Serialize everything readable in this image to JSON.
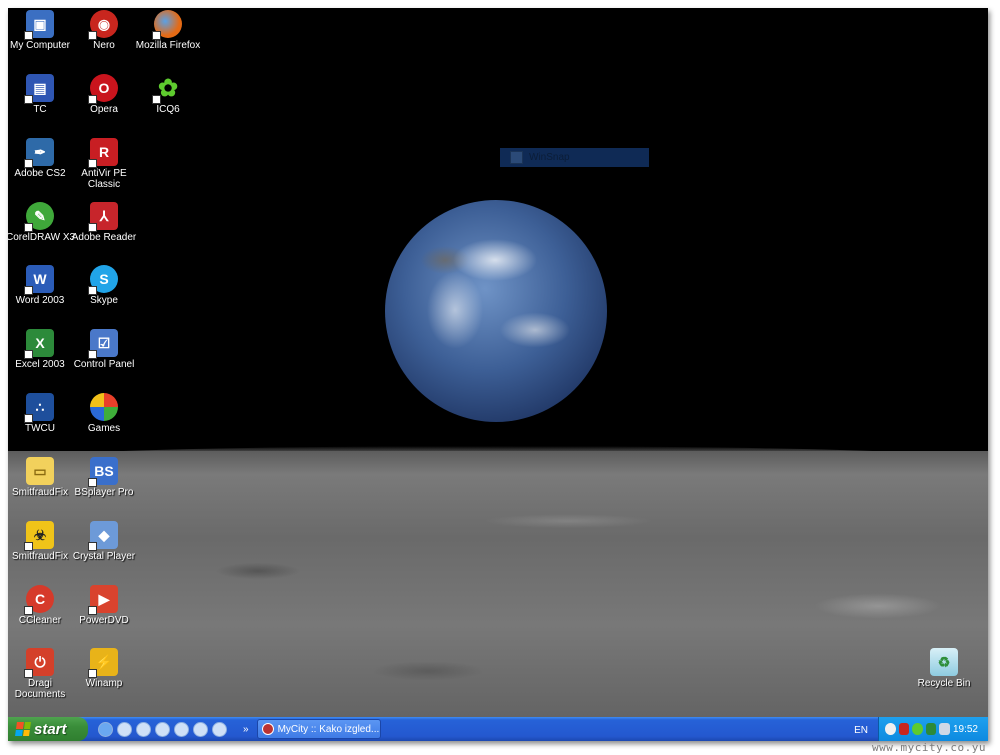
{
  "desktop": {
    "icons": [
      {
        "label": "My Computer",
        "icon": "computer-icon",
        "color": "#3b6fc2"
      },
      {
        "label": "Nero",
        "icon": "nero-icon",
        "color": "#c8261e"
      },
      {
        "label": "Mozilla Firefox",
        "icon": "firefox-icon",
        "color": "#e46a15"
      },
      {
        "label": "TC",
        "icon": "floppy-icon",
        "color": "#2f56b3"
      },
      {
        "label": "Opera",
        "icon": "opera-icon",
        "color": "#c9141d"
      },
      {
        "label": "ICQ6",
        "icon": "icq-flower-icon",
        "color": "#5ecb2e"
      },
      {
        "label": "Adobe  CS2",
        "icon": "adobe-cs2-icon",
        "color": "#2e6aa8"
      },
      {
        "label": "AntiVir PE",
        "label2": "Classic",
        "icon": "antivir-icon",
        "color": "#c81e23"
      },
      {
        "label": "CorelDRAW X3",
        "icon": "coreldraw-icon",
        "color": "#3fa83a"
      },
      {
        "label": "Adobe Reader",
        "icon": "adobe-reader-icon",
        "color": "#c7252b"
      },
      {
        "label": "Word 2003",
        "icon": "word-icon",
        "color": "#2b5cb8"
      },
      {
        "label": "Skype",
        "icon": "skype-icon",
        "color": "#21a4e8"
      },
      {
        "label": "Excel 2003",
        "icon": "excel-icon",
        "color": "#2c8a3a"
      },
      {
        "label": "Control Panel",
        "icon": "control-panel-icon",
        "color": "#4a78c9"
      },
      {
        "label": "TWCU",
        "icon": "twcu-icon",
        "color": "#1e4f9c"
      },
      {
        "label": "Games",
        "icon": "games-icon",
        "color": "#e8a419"
      },
      {
        "label": "SmitfraudFix",
        "icon": "folder-icon",
        "color": "#f2d15c"
      },
      {
        "label": "BSplayer Pro",
        "icon": "bsplayer-icon",
        "color": "#3a6fcb"
      },
      {
        "label": "SmitfraudFix",
        "icon": "biohazard-icon",
        "color": "#f0c419"
      },
      {
        "label": "Crystal Player",
        "icon": "crystal-player-icon",
        "color": "#6d9ad8"
      },
      {
        "label": "CCleaner",
        "icon": "ccleaner-icon",
        "color": "#d63a2a"
      },
      {
        "label": "PowerDVD",
        "icon": "powerdvd-icon",
        "color": "#d9432e"
      },
      {
        "label": "Dragi",
        "label2": "Documents",
        "icon": "power-button-icon",
        "color": "#d4402a"
      },
      {
        "label": "Winamp",
        "icon": "winamp-bolt-icon",
        "color": "#e8b319"
      },
      {
        "label": "Recycle Bin",
        "icon": "recycle-bin-icon",
        "color": "#9ed7e6"
      }
    ]
  },
  "winsnap": {
    "label": "WinSnap"
  },
  "taskbar": {
    "start_label": "start",
    "quick_launch": [
      "ie-icon",
      "chrome-like-icon",
      "desktop-icon",
      "eye-icon",
      "eye-icon-2",
      "user-icon",
      "user-icon-2"
    ],
    "overflow": "»",
    "task_label": "MyCity :: Kako izgled...",
    "language": "EN",
    "clock": "19:52"
  },
  "watermark": "www.mycity.co.yu"
}
